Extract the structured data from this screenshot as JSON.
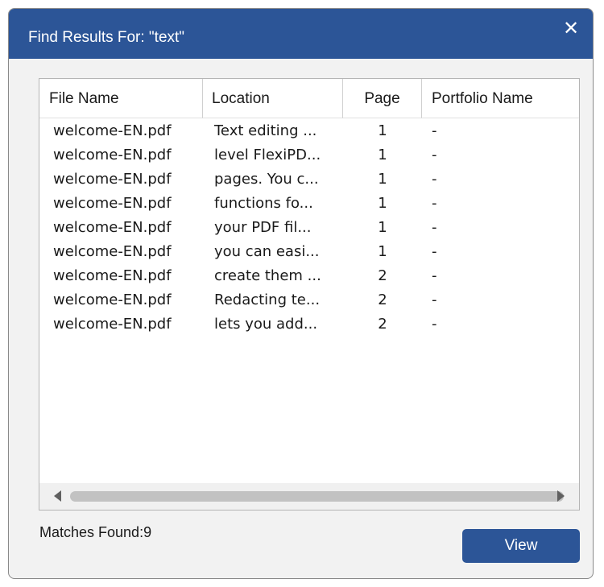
{
  "dialog": {
    "title": "Find Results For: \"text\"",
    "close_glyph": "✕"
  },
  "table": {
    "columns": [
      "File Name",
      "Location",
      "Page",
      "Portfolio Name"
    ],
    "rows": [
      {
        "file": "welcome-EN.pdf",
        "location": "Text editing ...",
        "page": "1",
        "portfolio": "-"
      },
      {
        "file": "welcome-EN.pdf",
        "location": "level FlexiPD...",
        "page": "1",
        "portfolio": "-"
      },
      {
        "file": "welcome-EN.pdf",
        "location": "pages. You c...",
        "page": "1",
        "portfolio": "-"
      },
      {
        "file": "welcome-EN.pdf",
        "location": "functions fo...",
        "page": "1",
        "portfolio": "-"
      },
      {
        "file": "welcome-EN.pdf",
        "location": "your PDF fil...",
        "page": "1",
        "portfolio": "-"
      },
      {
        "file": "welcome-EN.pdf",
        "location": "you can easi...",
        "page": "1",
        "portfolio": "-"
      },
      {
        "file": "welcome-EN.pdf",
        "location": "create them ...",
        "page": "2",
        "portfolio": "-"
      },
      {
        "file": "welcome-EN.pdf",
        "location": "Redacting te...",
        "page": "2",
        "portfolio": "-"
      },
      {
        "file": "welcome-EN.pdf",
        "location": "lets you add...",
        "page": "2",
        "portfolio": "-"
      }
    ]
  },
  "footer": {
    "matches_text": "Matches Found:9",
    "view_label": "View"
  },
  "colors": {
    "accent": "#2c5597",
    "dialog_bg": "#f2f2f2"
  }
}
